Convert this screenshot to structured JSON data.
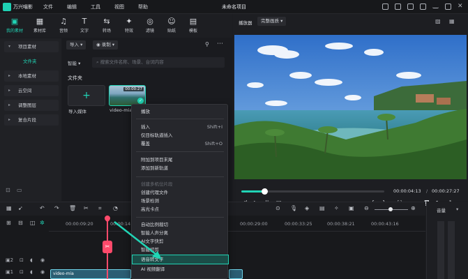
{
  "app": {
    "name": "万兴喵影",
    "menu": [
      "文件",
      "编辑",
      "工具",
      "视图",
      "帮助"
    ],
    "window_title": "未命名项目"
  },
  "toolbar": {
    "items": [
      {
        "label": "我的素材",
        "icon": "folder-icon",
        "glyph": "▣"
      },
      {
        "label": "素材库",
        "icon": "library-icon",
        "glyph": "▦"
      },
      {
        "label": "音频",
        "icon": "music-icon",
        "glyph": "♫"
      },
      {
        "label": "文字",
        "icon": "text-icon",
        "glyph": "T"
      },
      {
        "label": "转场",
        "icon": "transition-icon",
        "glyph": "⇆"
      },
      {
        "label": "特效",
        "icon": "effects-icon",
        "glyph": "✦"
      },
      {
        "label": "滤镜",
        "icon": "filter-icon",
        "glyph": "◎"
      },
      {
        "label": "贴纸",
        "icon": "sticker-icon",
        "glyph": "☺"
      },
      {
        "label": "模板",
        "icon": "template-icon",
        "glyph": "▤"
      }
    ]
  },
  "leftnav": {
    "items": [
      {
        "label": "项目素材"
      },
      {
        "label": "文件夹"
      },
      {
        "label": "本地素材"
      },
      {
        "label": "云空间"
      },
      {
        "label": "调整图层"
      },
      {
        "label": "复合片段"
      }
    ]
  },
  "media": {
    "import_label": "导入",
    "record_label": "录制",
    "smart_label": "智能",
    "search_placeholder": "搜索文件名称、场景、台词内容",
    "section_title": "文件夹",
    "import_media_label": "导入媒体",
    "clip_caption": "video-mia",
    "clip_duration": "00:00:27"
  },
  "player": {
    "tab_label": "播放器",
    "quality_label": "完整画质",
    "current_time": "00:00:04:13",
    "total_time": "00:00:27:27",
    "progress": 0.15
  },
  "timeline": {
    "times": [
      "00:00:09:20",
      "00:00:14:1",
      "00:00:29:00",
      "00:00:33:25",
      "00:00:38:21",
      "00:00:43:16"
    ],
    "clip_label": "video-mia",
    "meter_label": "音量"
  },
  "context_menu": {
    "items": [
      {
        "label": "播放",
        "shortcut": ""
      },
      {
        "label": "插入",
        "shortcut": "Shift+I"
      },
      {
        "label": "仅目标轨道插入",
        "shortcut": ""
      },
      {
        "label": "覆盖",
        "shortcut": "Shift+O"
      },
      {
        "label": "附加到项目末尾",
        "shortcut": ""
      },
      {
        "label": "添加到新轨道",
        "shortcut": ""
      },
      {
        "label": "创建多机位片段",
        "shortcut": ""
      },
      {
        "label": "创建代理文件",
        "shortcut": ""
      },
      {
        "label": "场景检测",
        "shortcut": ""
      },
      {
        "label": "高光卡点",
        "shortcut": ""
      },
      {
        "label": "自动比例裁切",
        "shortcut": ""
      },
      {
        "label": "智能人声分离",
        "shortcut": ""
      },
      {
        "label": "AI文字快剪",
        "shortcut": ""
      },
      {
        "label": "智能初剪",
        "shortcut": ""
      },
      {
        "label": "语音转文字",
        "shortcut": ""
      },
      {
        "label": "AI 视频翻译",
        "shortcut": ""
      }
    ]
  },
  "colors": {
    "accent": "#21d4b5",
    "playhead": "#ff4a6b",
    "background": "#1b1c20"
  }
}
